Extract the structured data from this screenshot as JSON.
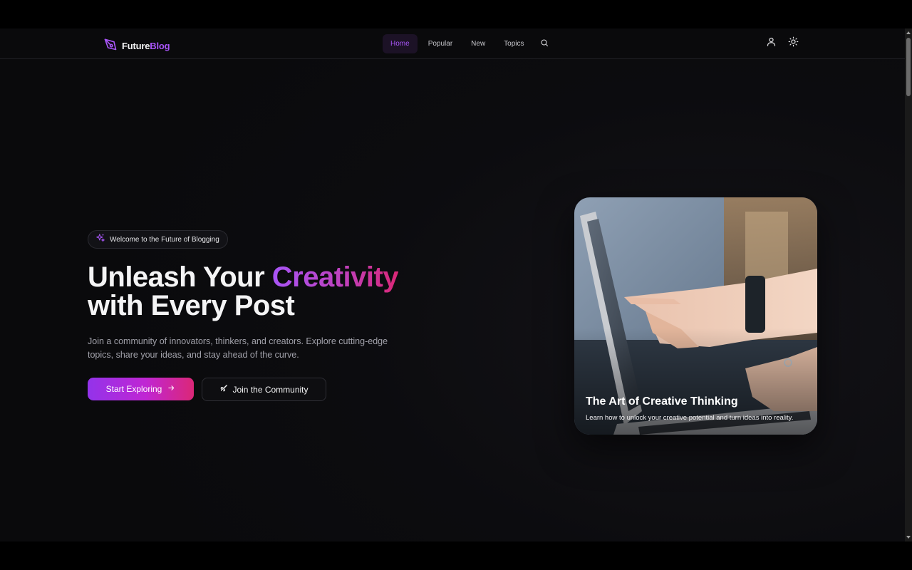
{
  "header": {
    "logo_part1": "Future",
    "logo_part2": "Blog",
    "logo_icon": "feather-pen-icon",
    "nav": [
      {
        "label": "Home",
        "active": true
      },
      {
        "label": "Popular",
        "active": false
      },
      {
        "label": "New",
        "active": false
      },
      {
        "label": "Topics",
        "active": false
      }
    ],
    "search_icon": "search-icon",
    "user_icon": "user-icon",
    "theme_icon": "sun-icon"
  },
  "hero": {
    "badge_icon": "sparkles-icon",
    "badge_text": "Welcome to the Future of Blogging",
    "title_part1": "Unleash Your ",
    "title_highlight": "Creativity",
    "title_part2": "with Every Post",
    "description": "Join a community of innovators, thinkers, and creators. Explore cutting-edge topics, share your ideas, and stay ahead of the curve.",
    "primary_button": "Start Exploring",
    "primary_button_icon": "arrow-right-icon",
    "secondary_button": "Join the Community",
    "secondary_button_icon": "rocket-icon"
  },
  "featured_card": {
    "title": "The Art of Creative Thinking",
    "subtitle": "Learn how to unlock your creative potential and turn ideas into reality."
  },
  "colors": {
    "accent": "#a855f7",
    "gradient_end": "#db2777",
    "background": "#0a0a0c"
  }
}
